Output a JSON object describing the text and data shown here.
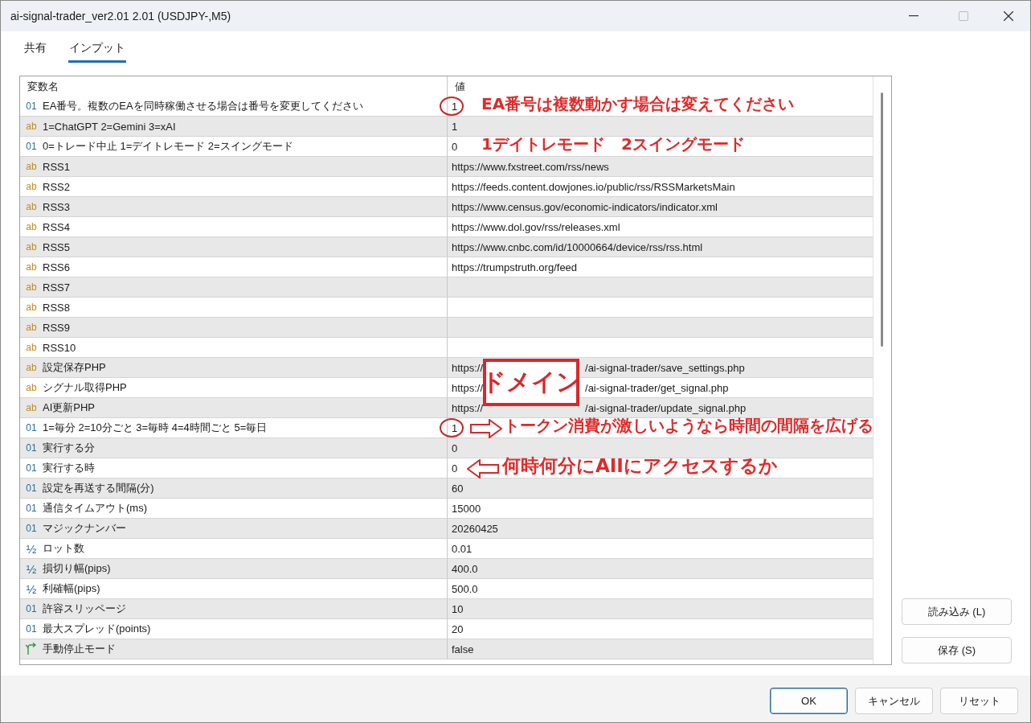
{
  "window": {
    "title": "ai-signal-trader_ver2.01 2.01 (USDJPY-,M5)"
  },
  "tabs": [
    {
      "label": "共有",
      "selected": false
    },
    {
      "label": "インプット",
      "selected": true
    }
  ],
  "table": {
    "columns": [
      "変数名",
      "値"
    ],
    "rows": [
      {
        "kind": "int",
        "icon": "01",
        "name": "EA番号。複数のEAを同時稼働させる場合は番号を変更してください",
        "value": "1",
        "circled": true,
        "note": "EA番号は複数動かす場合は変えてください"
      },
      {
        "kind": "string",
        "icon": "ab",
        "name": "1=ChatGPT 2=Gemini 3=xAI",
        "value": "1"
      },
      {
        "kind": "int",
        "icon": "01",
        "name": "0=トレード中止 1=デイトレモード 2=スイングモード",
        "value": "0",
        "note": "1デイトレモード　2スイングモード"
      },
      {
        "kind": "string",
        "icon": "ab",
        "name": "RSS1",
        "value": "https://www.fxstreet.com/rss/news"
      },
      {
        "kind": "string",
        "icon": "ab",
        "name": "RSS2",
        "value": "https://feeds.content.dowjones.io/public/rss/RSSMarketsMain"
      },
      {
        "kind": "string",
        "icon": "ab",
        "name": "RSS3",
        "value": "https://www.census.gov/economic-indicators/indicator.xml"
      },
      {
        "kind": "string",
        "icon": "ab",
        "name": "RSS4",
        "value": "https://www.dol.gov/rss/releases.xml"
      },
      {
        "kind": "string",
        "icon": "ab",
        "name": "RSS5",
        "value": "https://www.cnbc.com/id/10000664/device/rss/rss.html"
      },
      {
        "kind": "string",
        "icon": "ab",
        "name": "RSS6",
        "value": "https://trumpstruth.org/feed"
      },
      {
        "kind": "string",
        "icon": "ab",
        "name": "RSS7"
      },
      {
        "kind": "string",
        "icon": "ab",
        "name": "RSS8"
      },
      {
        "kind": "string",
        "icon": "ab",
        "name": "RSS9"
      },
      {
        "kind": "string",
        "icon": "ab",
        "name": "RSS10"
      },
      {
        "kind": "string",
        "icon": "ab",
        "name": "設定保存PHP",
        "value": "https://",
        "value_end": "/ai-signal-trader/save_settings.php",
        "cover": "ドメイン"
      },
      {
        "kind": "string",
        "icon": "ab",
        "name": "シグナル取得PHP",
        "value": "https://",
        "value_end": "/ai-signal-trader/get_signal.php"
      },
      {
        "kind": "string",
        "icon": "ab",
        "name": "AI更新PHP",
        "value": "https://",
        "value_end": "/ai-signal-trader/update_signal.php"
      },
      {
        "kind": "int",
        "icon": "01",
        "name": "1=毎分 2=10分ごと 3=毎時 4=4時間ごと 5=毎日",
        "value": "1",
        "circled": true,
        "arrow_right": true,
        "note": "トークン消費が激しいようなら時間の間隔を広げる"
      },
      {
        "kind": "int",
        "icon": "01",
        "name": "実行する分",
        "value": "0"
      },
      {
        "kind": "int",
        "icon": "01",
        "name": "実行する時",
        "value": "0",
        "arrow_left": true,
        "note": "何時何分にAIIにアクセスするか"
      },
      {
        "kind": "int",
        "icon": "01",
        "name": "設定を再送する間隔(分)",
        "value": "60"
      },
      {
        "kind": "int",
        "icon": "01",
        "name": "通信タイムアウト(ms)",
        "value": "15000"
      },
      {
        "kind": "int",
        "icon": "01",
        "name": "マジックナンバー",
        "value": "20260425"
      },
      {
        "kind": "double",
        "icon": "½",
        "name": "ロット数",
        "value": "0.01"
      },
      {
        "kind": "double",
        "icon": "½",
        "name": "損切り幅(pips)",
        "value": "400.0"
      },
      {
        "kind": "double",
        "icon": "½",
        "name": "利確幅(pips)",
        "value": "500.0"
      },
      {
        "kind": "int",
        "icon": "01",
        "name": "許容スリッページ",
        "value": "10"
      },
      {
        "kind": "int",
        "icon": "01",
        "name": "最大スプレッド(points)",
        "value": "20"
      },
      {
        "kind": "bool",
        "name": "手動停止モード",
        "value": "false"
      }
    ]
  },
  "side_buttons": [
    "読み込み (L)",
    "保存 (S)"
  ],
  "footer_buttons": [
    {
      "label": "OK",
      "default": true
    },
    {
      "label": "キャンセル",
      "default": false
    },
    {
      "label": "リセット",
      "default": false
    }
  ]
}
